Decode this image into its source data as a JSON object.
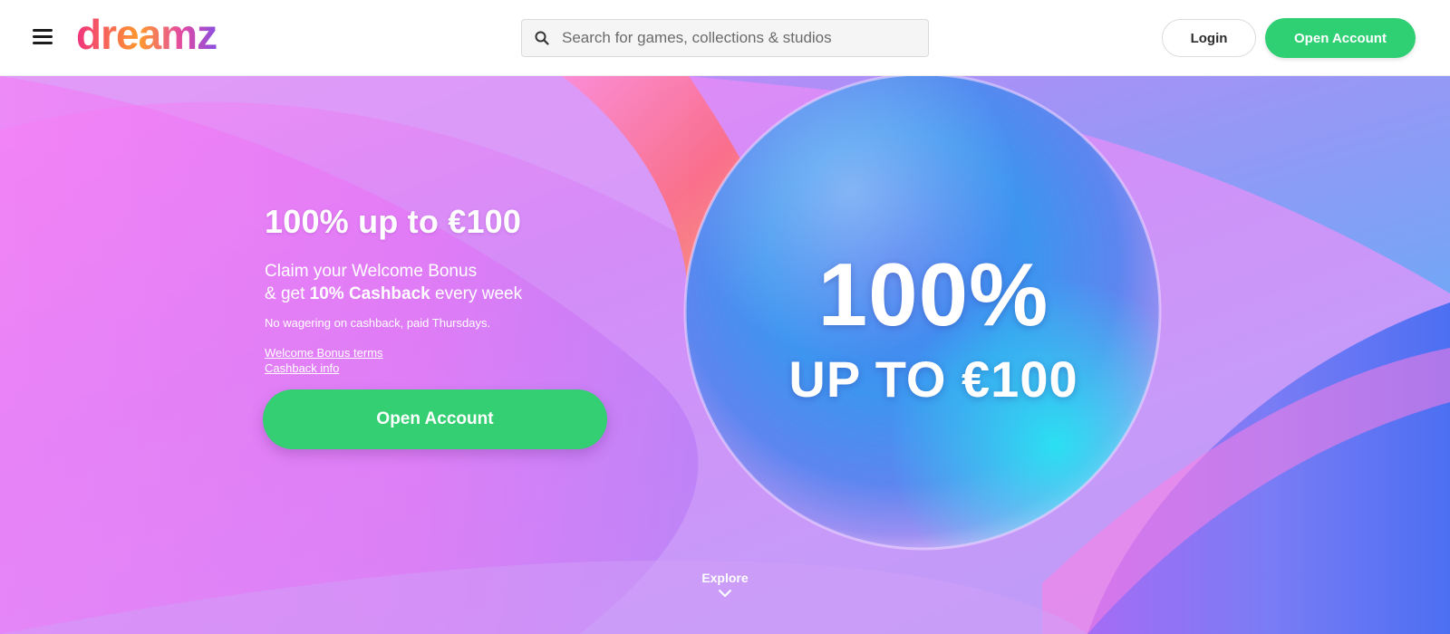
{
  "header": {
    "logo_text": "dreamz",
    "search_placeholder": "Search for games, collections & studios",
    "login_label": "Login",
    "open_account_label": "Open Account"
  },
  "hero": {
    "title": "100% up to €100",
    "subtitle_line1": "Claim your Welcome Bonus",
    "subtitle_line2_prefix": "& get ",
    "subtitle_line2_bold": "10% Cashback",
    "subtitle_line2_suffix": " every week",
    "note": "No wagering on cashback, paid Thursdays.",
    "link_bonus_terms": "Welcome Bonus terms",
    "link_cashback_info": "Cashback info",
    "cta_label": "Open Account",
    "bubble_line1": "100%",
    "bubble_line2": "UP TO €100",
    "explore_label": "Explore"
  },
  "icons": {
    "menu": "hamburger-menu-icon",
    "search": "search-icon",
    "explore": "chevron-down-icon"
  },
  "colors": {
    "accent_green": "#2fcf73",
    "logo_pink": "#f0337e",
    "logo_orange": "#ff9a2e",
    "logo_purple": "#8a4fe0"
  }
}
